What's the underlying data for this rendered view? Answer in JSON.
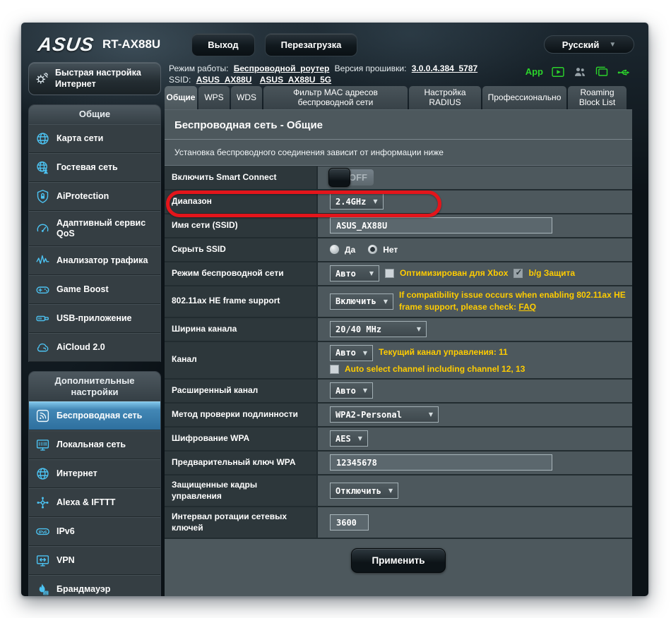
{
  "colors": {
    "accent_cyan": "#4cc2f1",
    "active_item_blue": "#3f85b5",
    "hint_yellow": "#ffcc00",
    "highlight_red": "#e3151b",
    "app_green": "#2bd42b"
  },
  "header": {
    "brand": "ASUS",
    "model": "RT-AX88U",
    "logout_label": "Выход",
    "reboot_label": "Перезагрузка",
    "language": "Русский"
  },
  "infobar": {
    "mode_label": "Режим работы:",
    "mode_value": "Беспроводной_роутер",
    "firmware_label": "Версия прошивки:",
    "firmware_value": "3.0.0.4.384_5787",
    "ssid_label": "SSID:",
    "ssid_link_1": "ASUS_AX88U",
    "ssid_link_2": "ASUS_AX88U_5G",
    "app_label": "App",
    "icons": [
      "play-app-icon",
      "clients-icon",
      "screens-icon",
      "usb-icon"
    ]
  },
  "sidebar": {
    "quick_setup_label": "Быстрая настройка Интернет",
    "sections": [
      {
        "title": "Общие",
        "items": [
          {
            "label": "Карта сети",
            "icon": "network-map-icon"
          },
          {
            "label": "Гостевая сеть",
            "icon": "guest-network-icon"
          },
          {
            "label": "AiProtection",
            "icon": "shield-lock-icon"
          },
          {
            "label": "Адаптивный сервис QoS",
            "icon": "qos-gauge-icon"
          },
          {
            "label": "Анализатор трафика",
            "icon": "traffic-analyzer-icon"
          },
          {
            "label": "Game Boost",
            "icon": "gamepad-icon"
          },
          {
            "label": "USB-приложение",
            "icon": "usb-drive-icon"
          },
          {
            "label": "AiCloud 2.0",
            "icon": "cloud-icon"
          }
        ]
      },
      {
        "title": "Дополнительные настройки",
        "items": [
          {
            "label": "Беспроводная сеть",
            "icon": "wireless-icon",
            "active": true
          },
          {
            "label": "Локальная сеть",
            "icon": "lan-icon"
          },
          {
            "label": "Интернет",
            "icon": "internet-globe-icon"
          },
          {
            "label": "Alexa & IFTTT",
            "icon": "alexa-ifttt-icon"
          },
          {
            "label": "IPv6",
            "icon": "ipv6-icon",
            "icon_text": "IPv6"
          },
          {
            "label": "VPN",
            "icon": "vpn-icon"
          },
          {
            "label": "Брандмауэр",
            "icon": "firewall-icon"
          }
        ]
      }
    ]
  },
  "tabs": [
    {
      "label": "Общие",
      "active": true
    },
    {
      "label": "WPS"
    },
    {
      "label": "WDS"
    },
    {
      "label": "Фильтр MAC адресов беспроводной сети"
    },
    {
      "label": "Настройка RADIUS"
    },
    {
      "label": "Профессионально"
    },
    {
      "label": "Roaming Block List"
    }
  ],
  "content": {
    "title": "Беспроводная сеть - Общие",
    "description": "Установка беспроводного соединения зависит от информации ниже",
    "apply_label": "Применить",
    "fields": {
      "smart_connect": {
        "label": "Включить Smart Connect",
        "state": "OFF"
      },
      "band": {
        "label": "Диапазон",
        "value": "2.4GHz"
      },
      "ssid": {
        "label": "Имя сети (SSID)",
        "value": "ASUS_AX88U"
      },
      "hide_ssid": {
        "label": "Скрыть SSID",
        "option_yes": "Да",
        "option_no": "Нет",
        "selected": "Нет"
      },
      "wireless_mode": {
        "label": "Режим беспроводной сети",
        "value": "Авто",
        "checkbox_xbox": "Оптимизирован для Xbox",
        "checkbox_bg": "b/g Защита"
      },
      "he_frame": {
        "label": "802.11ax HE frame support",
        "value": "Включить",
        "note": "If compatibility issue occurs when enabling 802.11ax HE frame support, please check:",
        "note_link": "FAQ"
      },
      "channel_width": {
        "label": "Ширина канала",
        "value": "20/40 MHz"
      },
      "channel": {
        "label": "Канал",
        "value": "Авто",
        "note": "Текущий канал управления: 11",
        "checkbox": "Auto select channel including channel 12, 13"
      },
      "ext_channel": {
        "label": "Расширенный канал",
        "value": "Авто"
      },
      "auth_method": {
        "label": "Метод проверки подлинности",
        "value": "WPA2-Personal"
      },
      "wpa_encryption": {
        "label": "Шифрование WPA",
        "value": "AES"
      },
      "wpa_key": {
        "label": "Предварительный ключ WPA",
        "value": "12345678"
      },
      "pmf": {
        "label": "Защищенные кадры управления",
        "value": "Отключить"
      },
      "rotation": {
        "label": "Интервал ротации сетевых ключей",
        "value": "3600"
      }
    }
  }
}
